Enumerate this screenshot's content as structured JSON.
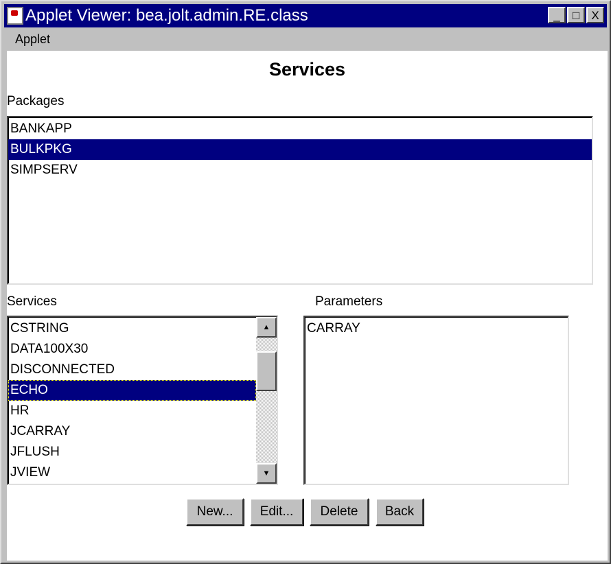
{
  "window": {
    "title": "Applet Viewer: bea.jolt.admin.RE.class",
    "minimize": "_",
    "maximize": "□",
    "close": "X"
  },
  "menubar": {
    "applet": "Applet"
  },
  "heading": "Services",
  "packages": {
    "label": "Packages",
    "items": [
      "BANKAPP",
      "BULKPKG",
      "SIMPSERV"
    ],
    "selected": "BULKPKG"
  },
  "services": {
    "label": "Services",
    "items": [
      "CSTRING",
      "DATA100X30",
      "DISCONNECTED",
      "ECHO",
      "HR",
      "JCARRAY",
      "JFLUSH",
      "JVIEW"
    ],
    "selected": "ECHO",
    "scroll_up": "▲",
    "scroll_down": "▼"
  },
  "parameters": {
    "label": "Parameters",
    "items": [
      "CARRAY"
    ]
  },
  "buttons": {
    "new": "New...",
    "edit": "Edit...",
    "delete": "Delete",
    "back": "Back"
  }
}
